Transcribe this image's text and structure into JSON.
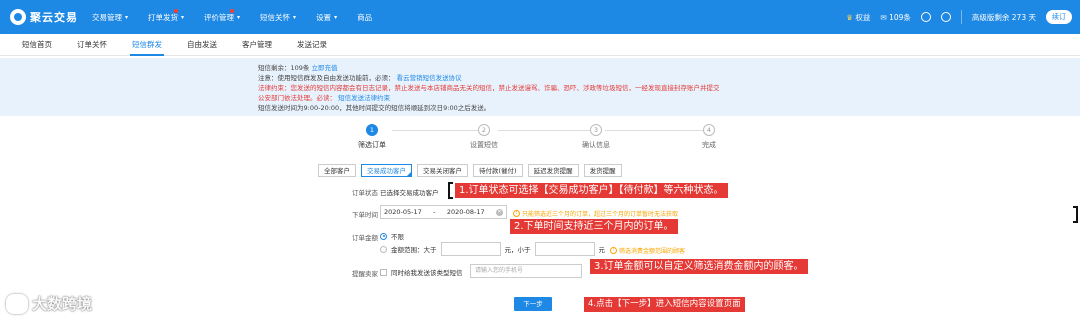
{
  "header": {
    "logo_text": "聚云交易",
    "nav": [
      {
        "label": "交易管理",
        "caret": true,
        "dot": false
      },
      {
        "label": "打单发货",
        "caret": true,
        "dot": true
      },
      {
        "label": "评价管理",
        "caret": true,
        "dot": true
      },
      {
        "label": "短信关怀",
        "caret": true,
        "dot": false
      },
      {
        "label": "设置",
        "caret": true,
        "dot": false
      },
      {
        "label": "商品",
        "caret": false,
        "dot": false
      }
    ],
    "rights_label": "权益",
    "sms_count": "109条",
    "edition": "高级版剩余 273 天",
    "renew_label": "续订"
  },
  "subnav": {
    "items": [
      "短信首页",
      "订单关怀",
      "短信群发",
      "自由发送",
      "客户管理",
      "发送记录"
    ],
    "active_index": 2
  },
  "notice": {
    "line1_prefix": "短信剩余：109条",
    "line1_link": "立即充值",
    "line2_prefix": "注意：使用短信群发及自由发送功能前，必须：",
    "line2_link": "看云营销短信发送协议",
    "line3": "法律约束：您发送的短信内容都会有日志记录，禁止发送与本店铺商品无关的短信，禁止发送谩骂、诈骗、恐吓、涉政等垃圾短信，一经发现直接封存账户并提交",
    "line4_prefix": "公安部门依法处理。必读：",
    "line4_link": "短信发送法律约束",
    "line5": "短信发送时间为9:00-20:00，其他时间提交的短信将顺延到次日9:00之后发送。"
  },
  "steps": [
    {
      "num": "1",
      "label": "筛选订单",
      "active": true
    },
    {
      "num": "2",
      "label": "设置短信",
      "active": false
    },
    {
      "num": "3",
      "label": "确认信息",
      "active": false
    },
    {
      "num": "4",
      "label": "完成",
      "active": false
    }
  ],
  "filters": {
    "buttons": [
      "全部客户",
      "交易成功客户",
      "交易关闭客户",
      "待付款(催付)",
      "延迟发货提醒",
      "发货提醒"
    ],
    "active_index": 1
  },
  "form": {
    "order_status_label": "订单状态",
    "order_status_value": "已选择交易成功客户",
    "order_time_label": "下单时间",
    "date_start": "2020-05-17",
    "date_sep": "-",
    "date_end": "2020-08-17",
    "date_hint": "只能筛选近三个月的订单，超过三个月的订单暂时无法获取",
    "amount_label": "订单金额",
    "amount_unlimited": "不限",
    "amount_range": "金额范围：大于",
    "amount_unit1": "元，小于",
    "amount_unit2": "元",
    "amount_hint": "筛选消费金额范围的顾客",
    "remind_label": "提醒卖家",
    "remind_checkbox_label": "同时给我发送该类型短信",
    "phone_placeholder": "请输入您的手机号",
    "next_label": "下一步"
  },
  "callouts": {
    "c1": "1.订单状态可选择【交易成功客户】【待付款】等六种状态。",
    "c2": "2.下单时间支持近三个月内的订单。",
    "c3": "3.订单金额可以自定义筛选消费金额内的顾客。",
    "c4": "4.点击【下一步】进入短信内容设置页面"
  },
  "watermark": "大数跨境"
}
